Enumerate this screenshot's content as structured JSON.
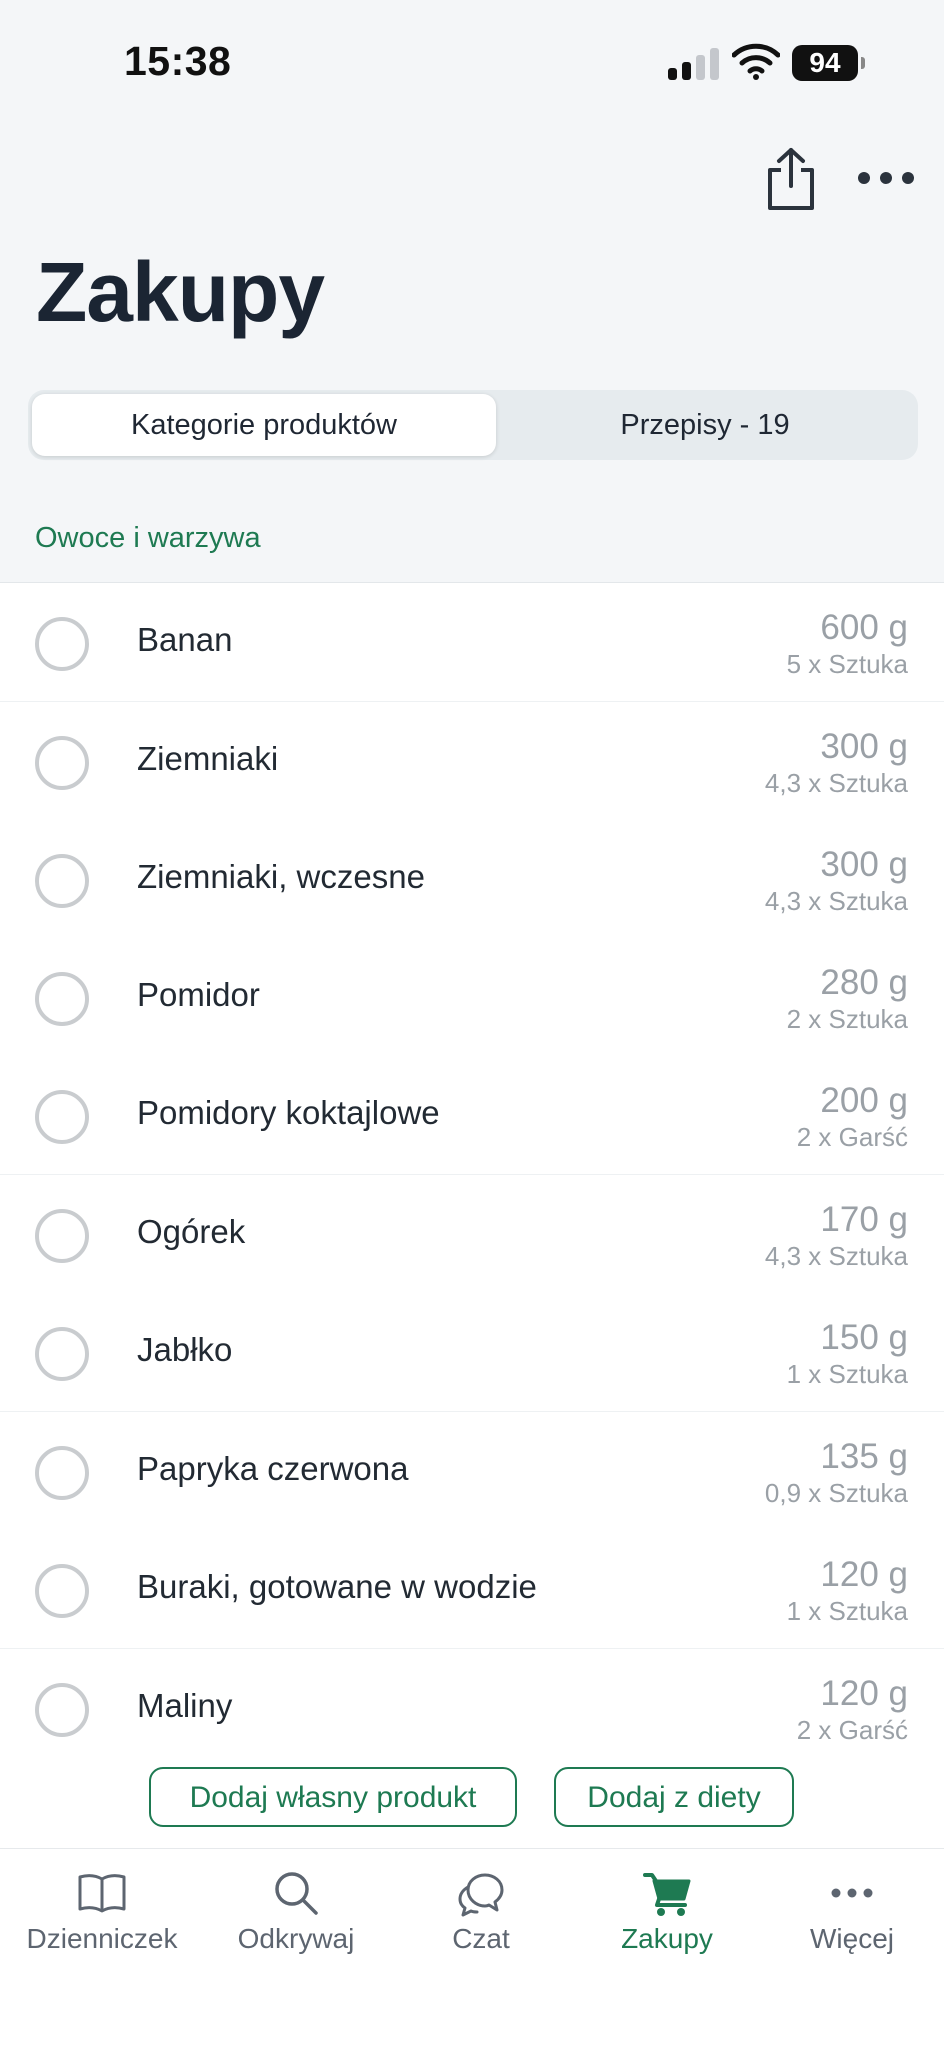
{
  "status_bar": {
    "time": "15:38",
    "battery": "94"
  },
  "header": {
    "title": "Zakupy"
  },
  "segments": [
    {
      "label": "Kategorie produktów",
      "active": true
    },
    {
      "label": "Przepisy - 19",
      "active": false
    }
  ],
  "category": "Owoce i warzywa",
  "items": [
    {
      "name": "Banan",
      "qty": "600 g",
      "sub": "5 x Sztuka"
    },
    {
      "name": "Ziemniaki",
      "qty": "300 g",
      "sub": "4,3 x Sztuka"
    },
    {
      "name": "Ziemniaki, wczesne",
      "qty": "300 g",
      "sub": "4,3 x Sztuka"
    },
    {
      "name": "Pomidor",
      "qty": "280 g",
      "sub": "2 x Sztuka"
    },
    {
      "name": "Pomidory koktajlowe",
      "qty": "200 g",
      "sub": "2 x Garść"
    },
    {
      "name": "Ogórek",
      "qty": "170 g",
      "sub": "4,3 x Sztuka"
    },
    {
      "name": "Jabłko",
      "qty": "150 g",
      "sub": "1 x Sztuka"
    },
    {
      "name": "Papryka czerwona",
      "qty": "135 g",
      "sub": "0,9 x Sztuka"
    },
    {
      "name": "Buraki, gotowane w wodzie",
      "qty": "120 g",
      "sub": "1 x Sztuka"
    },
    {
      "name": "Maliny",
      "qty": "120 g",
      "sub": "2 x Garść"
    }
  ],
  "actions": {
    "add_own": "Dodaj własny produkt",
    "add_from_diet": "Dodaj z diety"
  },
  "tabs": [
    {
      "label": "Dzienniczek",
      "icon": "book-icon"
    },
    {
      "label": "Odkrywaj",
      "icon": "search-icon"
    },
    {
      "label": "Czat",
      "icon": "chat-icon"
    },
    {
      "label": "Zakupy",
      "icon": "cart-icon",
      "active": true
    },
    {
      "label": "Więcej",
      "icon": "more-icon"
    }
  ],
  "colors": {
    "accent": "#1e7a52",
    "background": "#f4f6f8",
    "muted": "#9aa0a6"
  }
}
